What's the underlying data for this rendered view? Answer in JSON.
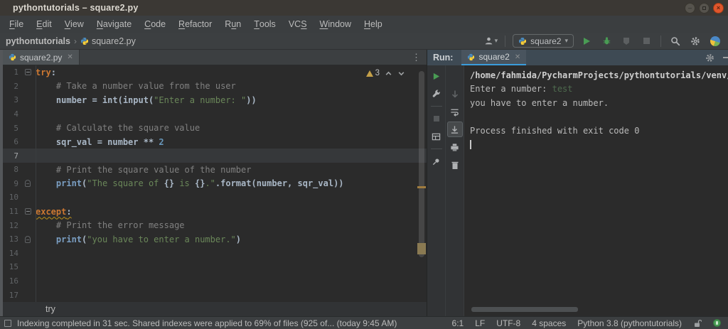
{
  "colors": {
    "accent_blue": "#3A9CDB",
    "keyword_orange": "#CC7832",
    "string_green": "#6A8759",
    "warning_tan": "#C4A049",
    "run_green": "#499C54",
    "close_button_orange": "#E0562C"
  },
  "icons": {
    "python-logo": "two-tone snake",
    "run": "green triangle",
    "debug": "green bug",
    "coverage": "gray shield",
    "stop": "gray square",
    "search": "magnifier",
    "settings": "gear",
    "user": "person silhouette",
    "pin": "pushpin",
    "soft-wrap": "wrapped arrow",
    "scroll-to-end": "arrow to line",
    "print": "printer",
    "clear": "trash can",
    "unlock": "open padlock",
    "notifications": "green circle"
  },
  "titlebar": {
    "title": "pythontutorials – square2.py"
  },
  "menu": {
    "items": [
      {
        "pre": "",
        "u": "F",
        "post": "ile"
      },
      {
        "pre": "",
        "u": "E",
        "post": "dit"
      },
      {
        "pre": "",
        "u": "V",
        "post": "iew"
      },
      {
        "pre": "",
        "u": "N",
        "post": "avigate"
      },
      {
        "pre": "",
        "u": "C",
        "post": "ode"
      },
      {
        "pre": "",
        "u": "R",
        "post": "efactor"
      },
      {
        "pre": "R",
        "u": "u",
        "post": "n"
      },
      {
        "pre": "",
        "u": "T",
        "post": "ools"
      },
      {
        "pre": "VC",
        "u": "S",
        "post": ""
      },
      {
        "pre": "",
        "u": "W",
        "post": "indow"
      },
      {
        "pre": "",
        "u": "H",
        "post": "elp"
      }
    ]
  },
  "toolbar": {
    "project": "pythontutorials",
    "file": "square2.py",
    "run_config": "square2"
  },
  "editor": {
    "tab": {
      "label": "square2.py"
    },
    "inspection": {
      "warning_count": "3"
    },
    "breadcrumb": "try",
    "lines": [
      {
        "n": "1",
        "fold": "collapse",
        "seg": [
          [
            "kw",
            "try"
          ],
          [
            "plain",
            ":"
          ]
        ]
      },
      {
        "n": "2",
        "seg": [
          [
            "comment",
            "    # Take a number value from the user"
          ]
        ]
      },
      {
        "n": "3",
        "seg": [
          [
            "plain",
            "    number = int(input("
          ],
          [
            "str",
            "\"Enter a number: \""
          ],
          [
            "plain",
            "))"
          ]
        ]
      },
      {
        "n": "4",
        "seg": []
      },
      {
        "n": "5",
        "seg": [
          [
            "comment",
            "    # Calculate the square value"
          ]
        ]
      },
      {
        "n": "6",
        "seg": [
          [
            "plain",
            "    sqr_val = number ** "
          ],
          [
            "num",
            "2"
          ]
        ]
      },
      {
        "n": "7",
        "current": true,
        "seg": []
      },
      {
        "n": "8",
        "seg": [
          [
            "comment",
            "    # Print the square value of the number"
          ]
        ]
      },
      {
        "n": "9",
        "fold": "end",
        "seg": [
          [
            "plain",
            "    "
          ],
          [
            "fn",
            "print"
          ],
          [
            "plain",
            "("
          ],
          [
            "str",
            "\"The square of "
          ],
          [
            "brace",
            "{}"
          ],
          [
            "str",
            " is "
          ],
          [
            "brace",
            "{}"
          ],
          [
            "str",
            ".\""
          ],
          [
            "plain",
            ".format(number, sqr_val))"
          ]
        ]
      },
      {
        "n": "10",
        "seg": []
      },
      {
        "n": "11",
        "fold": "collapse",
        "seg": [
          [
            "kw wavy",
            "except"
          ],
          [
            "plain wavy",
            ":"
          ]
        ]
      },
      {
        "n": "12",
        "seg": [
          [
            "comment",
            "    # Print the error message"
          ]
        ]
      },
      {
        "n": "13",
        "fold": "end",
        "seg": [
          [
            "plain",
            "    "
          ],
          [
            "fn",
            "print"
          ],
          [
            "plain",
            "("
          ],
          [
            "str",
            "\"you have to enter a number.\""
          ],
          [
            "plain",
            ")"
          ]
        ]
      },
      {
        "n": "14",
        "seg": []
      },
      {
        "n": "15",
        "seg": []
      },
      {
        "n": "16",
        "seg": []
      },
      {
        "n": "17",
        "seg": []
      }
    ]
  },
  "run_panel": {
    "label": "Run:",
    "tab": "square2",
    "console": [
      {
        "cls": "c-bold",
        "seg": [
          [
            "out",
            "/home/fahmida/PycharmProjects/pythontutorials/venv/b"
          ]
        ]
      },
      {
        "seg": [
          [
            "out",
            "Enter a number: "
          ],
          [
            "inp",
            "test"
          ]
        ]
      },
      {
        "seg": [
          [
            "out",
            "you have to enter a number."
          ]
        ]
      },
      {
        "seg": []
      },
      {
        "seg": [
          [
            "out",
            "Process finished with exit code 0"
          ]
        ]
      }
    ]
  },
  "status_bar": {
    "message": "Indexing completed in 31 sec. Shared indexes were applied to 69% of files (925 of... (today 9:45 AM)",
    "items": [
      "6:1",
      "LF",
      "UTF-8",
      "4 spaces",
      "Python 3.8 (pythontutorials)"
    ]
  }
}
